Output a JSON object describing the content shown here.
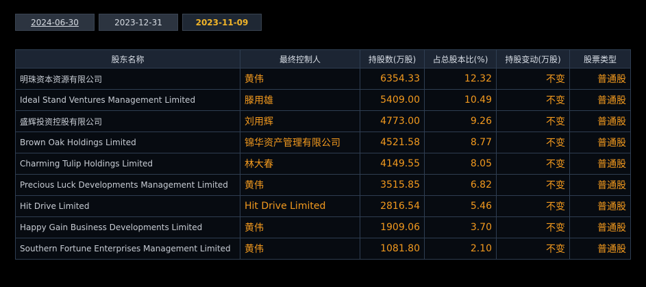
{
  "tabs": [
    {
      "label": "2024-06-30",
      "active": false
    },
    {
      "label": "2023-12-31",
      "active": false
    },
    {
      "label": "2023-11-09",
      "active": true
    }
  ],
  "table": {
    "headers": [
      "股东名称",
      "最终控制人",
      "持股数(万股)",
      "占总股本比(%)",
      "持股变动(万股)",
      "股票类型"
    ],
    "rows": [
      {
        "name": "明珠资本资源有限公司",
        "controller": "黄伟",
        "shares": "6354.33",
        "ratio": "12.32",
        "change": "不变",
        "type": "普通股"
      },
      {
        "name": "Ideal Stand Ventures Management Limited",
        "controller": "滕用雄",
        "shares": "5409.00",
        "ratio": "10.49",
        "change": "不变",
        "type": "普通股"
      },
      {
        "name": "盛辉投资控股有限公司",
        "controller": "刘用辉",
        "shares": "4773.00",
        "ratio": "9.26",
        "change": "不变",
        "type": "普通股"
      },
      {
        "name": "Brown Oak Holdings Limited",
        "controller": "锦华资产管理有限公司",
        "shares": "4521.58",
        "ratio": "8.77",
        "change": "不变",
        "type": "普通股"
      },
      {
        "name": "Charming Tulip Holdings Limited",
        "controller": "林大春",
        "shares": "4149.55",
        "ratio": "8.05",
        "change": "不变",
        "type": "普通股"
      },
      {
        "name": "Precious Luck Developments Management Limited",
        "controller": "黄伟",
        "shares": "3515.85",
        "ratio": "6.82",
        "change": "不变",
        "type": "普通股"
      },
      {
        "name": "Hit Drive Limited",
        "controller": "Hit Drive Limited",
        "shares": "2816.54",
        "ratio": "5.46",
        "change": "不变",
        "type": "普通股"
      },
      {
        "name": "Happy Gain Business Developments Limited",
        "controller": "黄伟",
        "shares": "1909.06",
        "ratio": "3.70",
        "change": "不变",
        "type": "普通股"
      },
      {
        "name": "Southern Fortune Enterprises Management Limited",
        "controller": "黄伟",
        "shares": "1081.80",
        "ratio": "2.10",
        "change": "不变",
        "type": "普通股"
      }
    ]
  },
  "colors": {
    "accent": "#f39a1e",
    "active_tab": "#f0b429",
    "border": "#2f3e52",
    "header_bg": "#1c2533"
  }
}
